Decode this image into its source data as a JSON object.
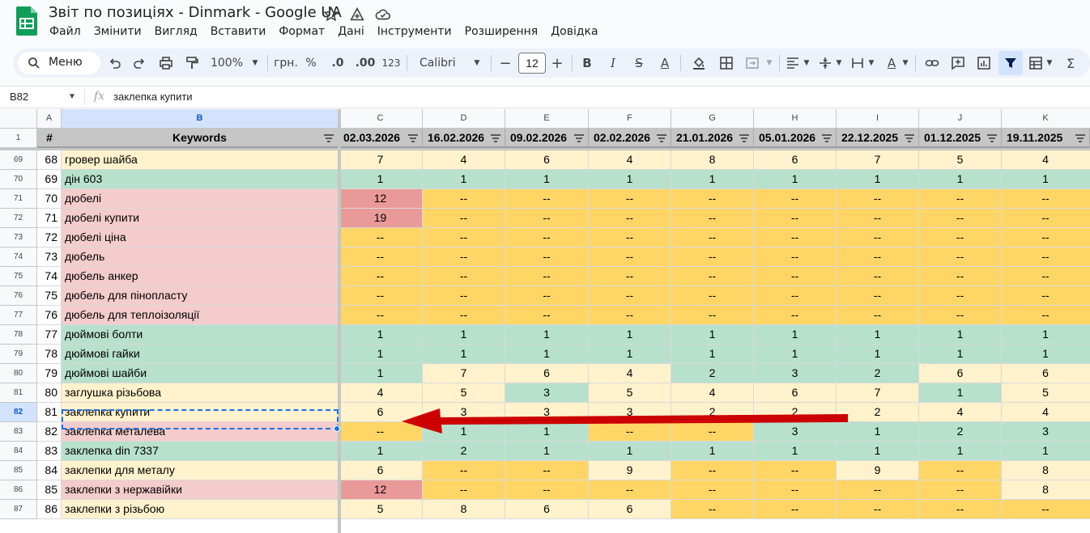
{
  "app": {
    "title": "Звіт по позиціях - Dinmark - Google UA",
    "menu": [
      "Файл",
      "Змінити",
      "Вигляд",
      "Вставити",
      "Формат",
      "Дані",
      "Інструменти",
      "Розширення",
      "Довідка"
    ]
  },
  "toolbar": {
    "search_label": "Меню",
    "zoom": "100%",
    "currency": "грн.",
    "percent": "%",
    "decrease_decimals": ".0",
    "increase_decimals": ".00",
    "number_format": "123",
    "font": "Calibri",
    "font_size": "12"
  },
  "formula_bar": {
    "name_box": "B82",
    "value": "заклепка купити"
  },
  "columns": [
    "A",
    "B",
    "C",
    "D",
    "E",
    "F",
    "G",
    "H",
    "I",
    "J",
    "K"
  ],
  "header_row": {
    "row_number": "1",
    "index_header": "#",
    "keyword_header": "Keywords",
    "dates": [
      "02.03.2026",
      "16.02.2026",
      "09.02.2026",
      "02.02.2026",
      "21.01.2026",
      "05.01.2026",
      "22.12.2025",
      "01.12.2025",
      "19.11.2025"
    ]
  },
  "colors": {
    "green": "#b7e1cd",
    "light_yellow": "#fff2cc",
    "yellow": "#ffd666",
    "pink": "#f4cccc",
    "red": "#ea9999",
    "arrow": "#cc0000"
  },
  "rows": [
    {
      "row": "69",
      "idx": "68",
      "kw": "гровер шайба",
      "kwc": "y",
      "vals": [
        "7",
        "4",
        "6",
        "4",
        "8",
        "6",
        "7",
        "5",
        "4"
      ],
      "c": [
        "y",
        "y",
        "y",
        "y",
        "y",
        "y",
        "y",
        "y",
        "y"
      ]
    },
    {
      "row": "70",
      "idx": "69",
      "kw": "дін 603",
      "kwc": "g",
      "vals": [
        "1",
        "1",
        "1",
        "1",
        "1",
        "1",
        "1",
        "1",
        "1"
      ],
      "c": [
        "g",
        "g",
        "g",
        "g",
        "g",
        "g",
        "g",
        "g",
        "g"
      ]
    },
    {
      "row": "71",
      "idx": "70",
      "kw": "дюбелі",
      "kwc": "p",
      "vals": [
        "12",
        "--",
        "--",
        "--",
        "--",
        "--",
        "--",
        "--",
        "--"
      ],
      "c": [
        "r",
        "o",
        "o",
        "o",
        "o",
        "o",
        "o",
        "o",
        "o"
      ]
    },
    {
      "row": "72",
      "idx": "71",
      "kw": "дюбелі купити",
      "kwc": "p",
      "vals": [
        "19",
        "--",
        "--",
        "--",
        "--",
        "--",
        "--",
        "--",
        "--"
      ],
      "c": [
        "r",
        "o",
        "o",
        "o",
        "o",
        "o",
        "o",
        "o",
        "o"
      ]
    },
    {
      "row": "73",
      "idx": "72",
      "kw": "дюбелі ціна",
      "kwc": "p",
      "vals": [
        "--",
        "--",
        "--",
        "--",
        "--",
        "--",
        "--",
        "--",
        "--"
      ],
      "c": [
        "o",
        "o",
        "o",
        "o",
        "o",
        "o",
        "o",
        "o",
        "o"
      ]
    },
    {
      "row": "74",
      "idx": "73",
      "kw": "дюбель",
      "kwc": "p",
      "vals": [
        "--",
        "--",
        "--",
        "--",
        "--",
        "--",
        "--",
        "--",
        "--"
      ],
      "c": [
        "o",
        "o",
        "o",
        "o",
        "o",
        "o",
        "o",
        "o",
        "o"
      ]
    },
    {
      "row": "75",
      "idx": "74",
      "kw": "дюбель анкер",
      "kwc": "p",
      "vals": [
        "--",
        "--",
        "--",
        "--",
        "--",
        "--",
        "--",
        "--",
        "--"
      ],
      "c": [
        "o",
        "o",
        "o",
        "o",
        "o",
        "o",
        "o",
        "o",
        "o"
      ]
    },
    {
      "row": "76",
      "idx": "75",
      "kw": "дюбель для пінопласту",
      "kwc": "p",
      "vals": [
        "--",
        "--",
        "--",
        "--",
        "--",
        "--",
        "--",
        "--",
        "--"
      ],
      "c": [
        "o",
        "o",
        "o",
        "o",
        "o",
        "o",
        "o",
        "o",
        "o"
      ]
    },
    {
      "row": "77",
      "idx": "76",
      "kw": "дюбель для теплоізоляції",
      "kwc": "p",
      "vals": [
        "--",
        "--",
        "--",
        "--",
        "--",
        "--",
        "--",
        "--",
        "--"
      ],
      "c": [
        "o",
        "o",
        "o",
        "o",
        "o",
        "o",
        "o",
        "o",
        "o"
      ]
    },
    {
      "row": "78",
      "idx": "77",
      "kw": "дюймові болти",
      "kwc": "g",
      "vals": [
        "1",
        "1",
        "1",
        "1",
        "1",
        "1",
        "1",
        "1",
        "1"
      ],
      "c": [
        "g",
        "g",
        "g",
        "g",
        "g",
        "g",
        "g",
        "g",
        "g"
      ]
    },
    {
      "row": "79",
      "idx": "78",
      "kw": "дюймові гайки",
      "kwc": "g",
      "vals": [
        "1",
        "1",
        "1",
        "1",
        "1",
        "1",
        "1",
        "1",
        "1"
      ],
      "c": [
        "g",
        "g",
        "g",
        "g",
        "g",
        "g",
        "g",
        "g",
        "g"
      ]
    },
    {
      "row": "80",
      "idx": "79",
      "kw": "дюймові шайби",
      "kwc": "g",
      "vals": [
        "1",
        "7",
        "6",
        "4",
        "2",
        "3",
        "2",
        "6",
        "6"
      ],
      "c": [
        "g",
        "y",
        "y",
        "y",
        "g",
        "g",
        "g",
        "y",
        "y"
      ]
    },
    {
      "row": "81",
      "idx": "80",
      "kw": "заглушка різьбова",
      "kwc": "y",
      "vals": [
        "4",
        "5",
        "3",
        "5",
        "4",
        "6",
        "7",
        "1",
        "5"
      ],
      "c": [
        "y",
        "y",
        "g",
        "y",
        "y",
        "y",
        "y",
        "g",
        "y"
      ]
    },
    {
      "row": "82",
      "idx": "81",
      "kw": "заклепка купити",
      "kwc": "y",
      "vals": [
        "6",
        "3",
        "3",
        "3",
        "2",
        "2",
        "2",
        "4",
        "4"
      ],
      "c": [
        "y",
        "y",
        "y",
        "y",
        "y",
        "y",
        "y",
        "y",
        "y"
      ]
    },
    {
      "row": "83",
      "idx": "82",
      "kw": "заклепка металева",
      "kwc": "p",
      "vals": [
        "--",
        "1",
        "1",
        "--",
        "--",
        "3",
        "1",
        "2",
        "3"
      ],
      "c": [
        "o",
        "g",
        "g",
        "o",
        "o",
        "g",
        "g",
        "g",
        "g"
      ]
    },
    {
      "row": "84",
      "idx": "83",
      "kw": "заклепка din 7337",
      "kwc": "g",
      "vals": [
        "1",
        "2",
        "1",
        "1",
        "1",
        "1",
        "1",
        "1",
        "1"
      ],
      "c": [
        "g",
        "g",
        "g",
        "g",
        "g",
        "g",
        "g",
        "g",
        "g"
      ]
    },
    {
      "row": "85",
      "idx": "84",
      "kw": "заклепки для металу",
      "kwc": "y",
      "vals": [
        "6",
        "--",
        "--",
        "9",
        "--",
        "--",
        "9",
        "--",
        "8"
      ],
      "c": [
        "y",
        "o",
        "o",
        "y",
        "o",
        "o",
        "y",
        "o",
        "y"
      ]
    },
    {
      "row": "86",
      "idx": "85",
      "kw": "заклепки з нержавійки",
      "kwc": "p",
      "vals": [
        "12",
        "--",
        "--",
        "--",
        "--",
        "--",
        "--",
        "--",
        "8"
      ],
      "c": [
        "r",
        "o",
        "o",
        "o",
        "o",
        "o",
        "o",
        "o",
        "y"
      ]
    },
    {
      "row": "87",
      "idx": "86",
      "kw": "заклепки з різьбою",
      "kwc": "y",
      "vals": [
        "5",
        "8",
        "6",
        "6",
        "--",
        "--",
        "--",
        "--",
        "--"
      ],
      "c": [
        "y",
        "y",
        "y",
        "y",
        "o",
        "o",
        "o",
        "o",
        "o"
      ]
    }
  ]
}
